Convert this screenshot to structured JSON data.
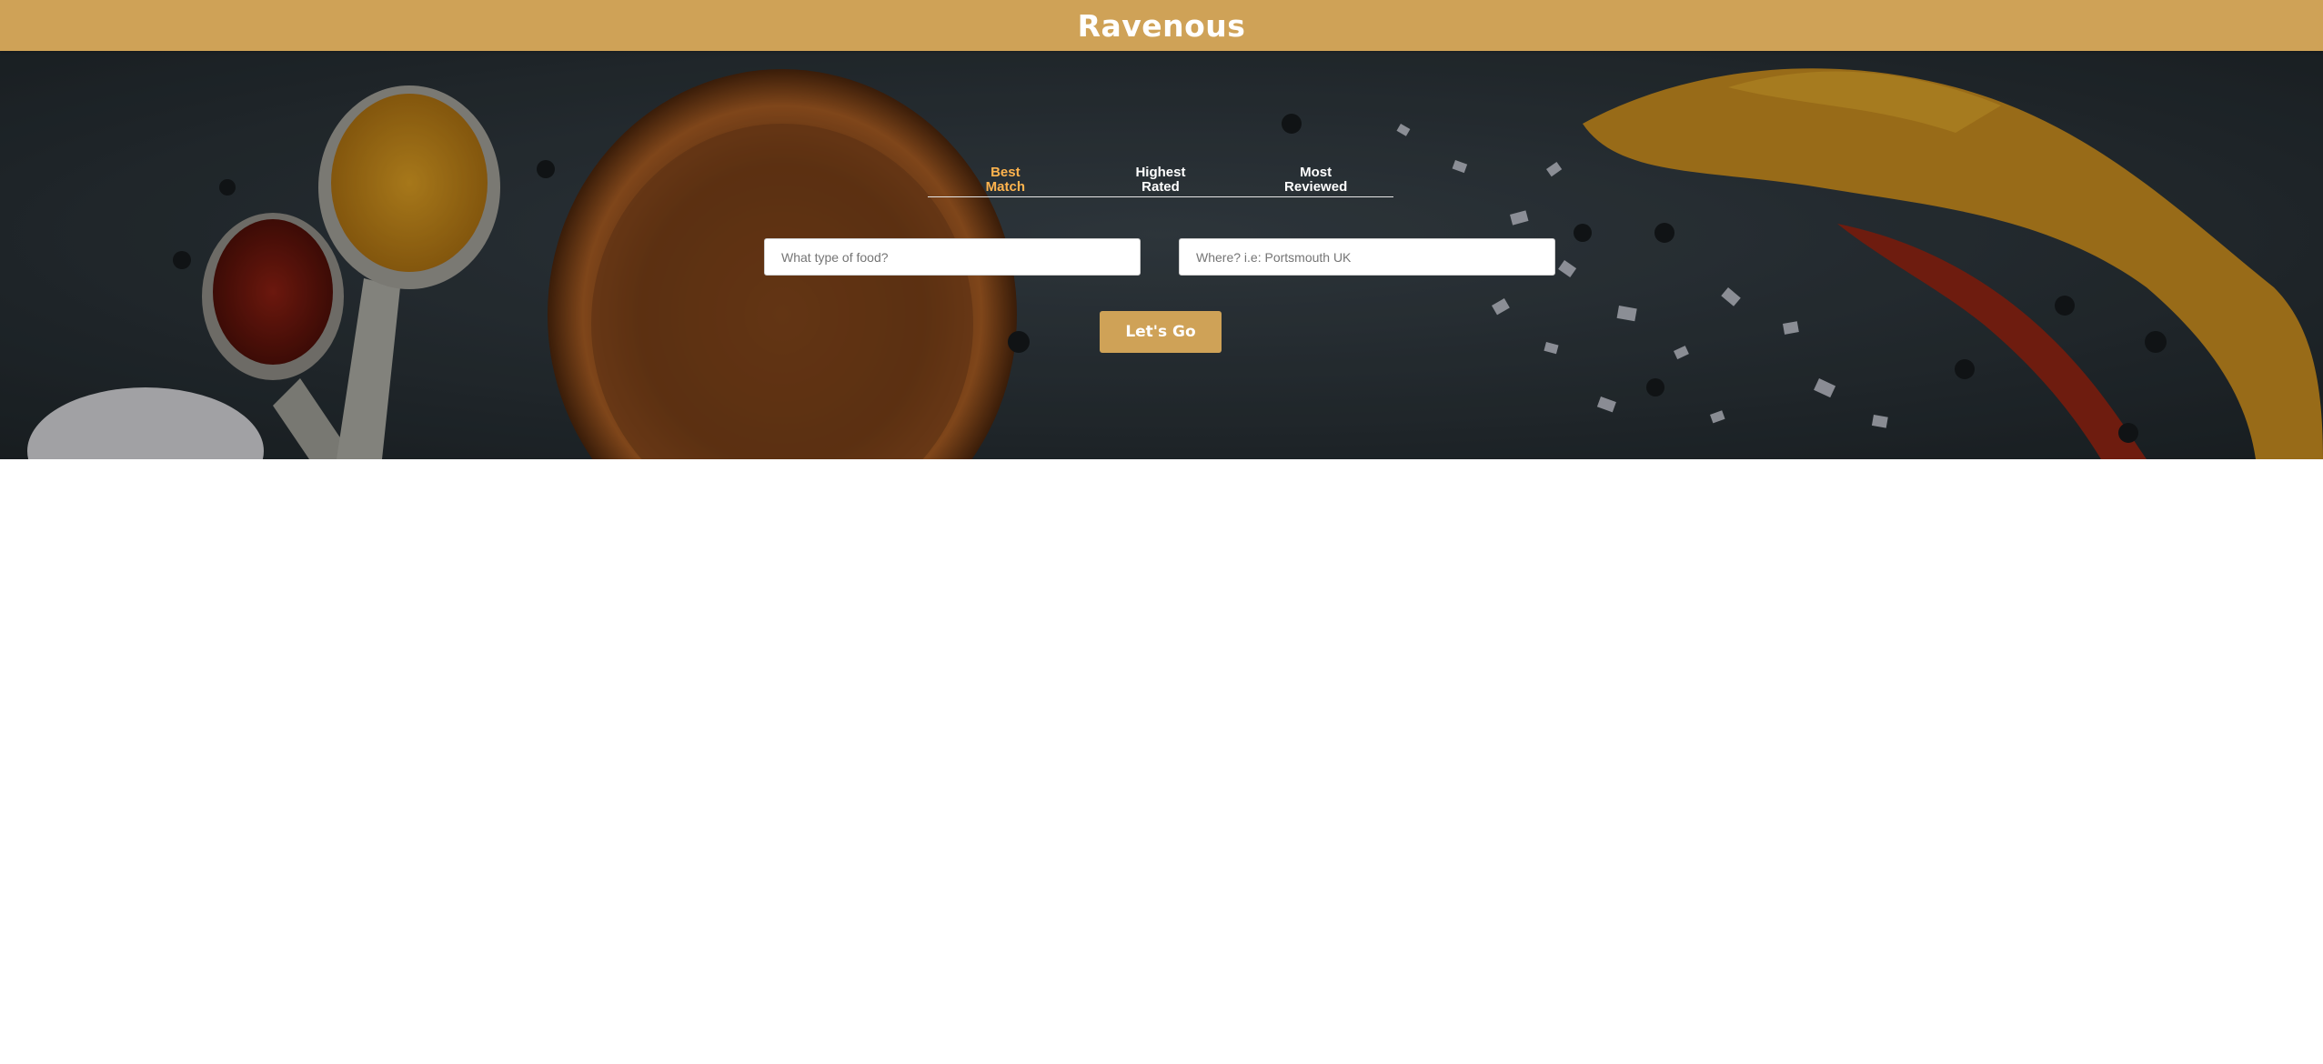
{
  "header": {
    "title": "Ravenous"
  },
  "sort_tabs": [
    {
      "line1": "Best",
      "line2": "Match",
      "active": true
    },
    {
      "line1": "Highest",
      "line2": "Rated",
      "active": false
    },
    {
      "line1": "Most",
      "line2": "Reviewed",
      "active": false
    }
  ],
  "search": {
    "term_placeholder": "What type of food?",
    "location_placeholder": "Where? i.e: Portsmouth UK",
    "submit_label": "Let's Go"
  },
  "colors": {
    "accent": "#cfa257",
    "active_tab": "#ffb44e",
    "hero_overlay": "#2b3339"
  }
}
